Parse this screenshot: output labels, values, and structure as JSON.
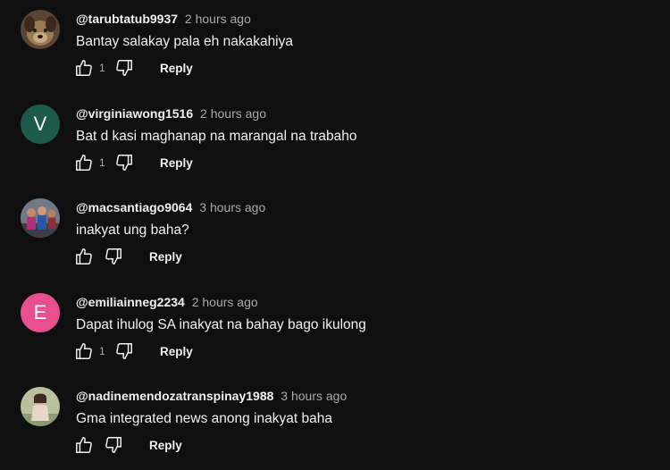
{
  "colors": {
    "background": "#0f0f0f",
    "avatar_v": "#1c5b49",
    "avatar_e": "#e84f8f"
  },
  "comments": [
    {
      "author": "@tarubtatub9937",
      "time": "2 hours ago",
      "text": "Bantay salakay pala eh nakakahiya",
      "likes": "1",
      "reply_label": "Reply",
      "avatar": {
        "type": "image",
        "desc": "dog-photo"
      }
    },
    {
      "author": "@virginiawong1516",
      "time": "2 hours ago",
      "text": "Bat d kasi maghanap na marangal na trabaho",
      "likes": "1",
      "reply_label": "Reply",
      "avatar": {
        "type": "letter",
        "letter": "V"
      }
    },
    {
      "author": "@macsantiago9064",
      "time": "3 hours ago",
      "text": "inakyat ung baha?",
      "likes": "",
      "reply_label": "Reply",
      "avatar": {
        "type": "image",
        "desc": "group-photo"
      }
    },
    {
      "author": "@emiliainneg2234",
      "time": "2 hours ago",
      "text": "Dapat ihulog SA inakyat na bahay bago ikulong",
      "likes": "1",
      "reply_label": "Reply",
      "avatar": {
        "type": "letter",
        "letter": "E"
      }
    },
    {
      "author": "@nadinemendozatranspinay1988",
      "time": "3 hours ago",
      "text": "Gma integrated news anong inakyat baha",
      "likes": "",
      "reply_label": "Reply",
      "avatar": {
        "type": "image",
        "desc": "person-photo"
      }
    }
  ]
}
